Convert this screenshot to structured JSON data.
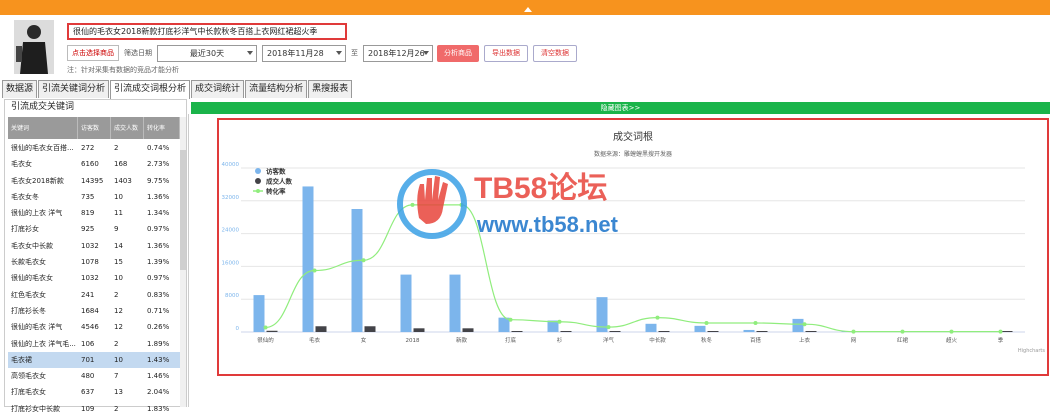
{
  "product": {
    "title": "很仙的毛衣女2018新款打底衫洋气中长款秋冬百搭上衣网红裙超火季"
  },
  "controls": {
    "select_product_label": "点击选择商品",
    "date_filter_label": "筛选日期",
    "date_range_value": "最近30天",
    "start_date": "2018年11月28",
    "to_label": "至",
    "end_date": "2018年12月26",
    "analyze_label": "分析商品",
    "export_label": "导出数据",
    "clear_label": "清空数据",
    "note": "注：针对采集有数据的竞品才能分析"
  },
  "tabs": [
    {
      "label": "数据源"
    },
    {
      "label": "引流关键词分析"
    },
    {
      "label": "引流成交词根分析"
    },
    {
      "label": "成交词统计"
    },
    {
      "label": "流量结构分析"
    },
    {
      "label": "黑搜报表"
    }
  ],
  "left_panel": {
    "title": "引流成交关键词",
    "columns": [
      "关键词",
      "访客数",
      "成交人数",
      "转化率"
    ],
    "rows": [
      [
        "很仙的毛衣女百搭...",
        "272",
        "2",
        "0.74%"
      ],
      [
        "毛衣女",
        "6160",
        "168",
        "2.73%"
      ],
      [
        "毛衣女2018新款",
        "14395",
        "1403",
        "9.75%"
      ],
      [
        "毛衣女冬",
        "735",
        "10",
        "1.36%"
      ],
      [
        "很仙的上衣 洋气",
        "819",
        "11",
        "1.34%"
      ],
      [
        "打底衫女",
        "925",
        "9",
        "0.97%"
      ],
      [
        "毛衣女中长款",
        "1032",
        "14",
        "1.36%"
      ],
      [
        "长款毛衣女",
        "1078",
        "15",
        "1.39%"
      ],
      [
        "很仙的毛衣女",
        "1032",
        "10",
        "0.97%"
      ],
      [
        "红色毛衣女",
        "241",
        "2",
        "0.83%"
      ],
      [
        "打底衫长冬",
        "1684",
        "12",
        "0.71%"
      ],
      [
        "很仙的毛衣 洋气",
        "4546",
        "12",
        "0.26%"
      ],
      [
        "很仙的上衣 洋气毛...",
        "106",
        "2",
        "1.89%"
      ],
      [
        "毛衣裙",
        "701",
        "10",
        "1.43%"
      ],
      [
        "高领毛衣女",
        "480",
        "7",
        "1.46%"
      ],
      [
        "打底毛衣女",
        "637",
        "13",
        "2.04%"
      ],
      [
        "打底衫女中长款",
        "109",
        "2",
        "1.83%"
      ]
    ]
  },
  "green_bar_label": "隐藏图表>>",
  "chart_data": {
    "type": "bar",
    "title": "成交词根",
    "subtitle": "数据来源：雕蝗蝗黑搜开发器",
    "credit": "Highcharts",
    "categories": [
      "很仙的",
      "毛衣",
      "女",
      "2018",
      "新款",
      "打底",
      "衫",
      "洋气",
      "中长款",
      "秋冬",
      "百搭",
      "上衣",
      "网",
      "红裙",
      "超火",
      "季"
    ],
    "ylim": [
      0,
      40000
    ],
    "yticks": [
      "0",
      "8000",
      "16000",
      "24000",
      "32000",
      "40000"
    ],
    "series": [
      {
        "name": "访客数",
        "type": "bar",
        "color": "#7cb5ec",
        "values": [
          9000,
          35500,
          30000,
          14000,
          14000,
          3500,
          2800,
          8500,
          2000,
          1500,
          500,
          3200,
          100,
          100,
          100,
          100
        ]
      },
      {
        "name": "成交人数",
        "type": "bar",
        "color": "#434348",
        "values": [
          300,
          1400,
          1400,
          900,
          900,
          100,
          60,
          100,
          50,
          40,
          10,
          60,
          5,
          5,
          5,
          5
        ]
      },
      {
        "name": "转化率",
        "type": "line",
        "color": "#90ed7d",
        "values": [
          1.1,
          15,
          17.5,
          31,
          31,
          3,
          2.5,
          1.2,
          3.5,
          2.2,
          2.2,
          1.9,
          0.1,
          0.1,
          0.1,
          0.1
        ]
      }
    ]
  }
}
